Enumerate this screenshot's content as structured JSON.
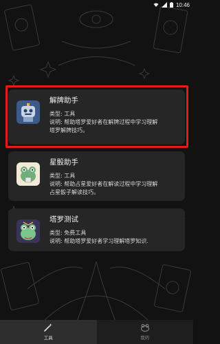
{
  "status_bar": {
    "time": "10:46"
  },
  "tools": [
    {
      "title": "解牌助手",
      "type_line": "类型: 工具",
      "desc_line1": "说明: 帮助塔罗爱好者在解牌过程中学习理解",
      "desc_line2": "塔罗解牌技巧。",
      "icon": "tarot-reading-robot-icon"
    },
    {
      "title": "星骰助手",
      "type_line": "类型: 工具",
      "desc_line1": "说明: 帮助占星爱好者在解读过程中学习理解",
      "desc_line2": "占星骰子解读技巧。",
      "icon": "astro-dice-frog-icon"
    },
    {
      "title": "塔罗测试",
      "type_line": "类型: 免费工具",
      "desc_line1": "说明: 帮助塔罗爱好者学习理解塔罗知识.",
      "icon": "tarot-test-frog-icon"
    }
  ],
  "tab_bar": {
    "tools_label": "工具",
    "mine_label": "我的"
  },
  "colors": {
    "background": "#121212",
    "card": "#262626",
    "highlight_box": "#e51b1b"
  }
}
